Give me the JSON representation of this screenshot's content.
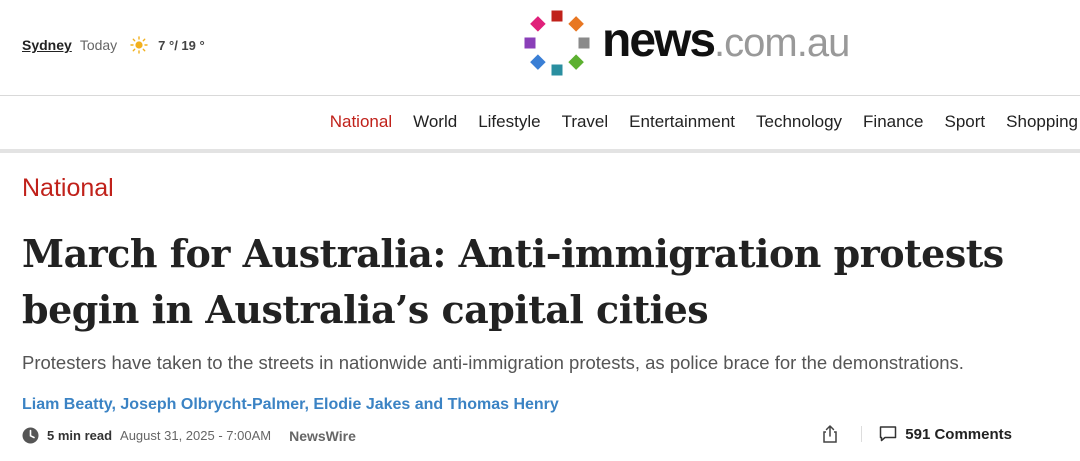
{
  "weather": {
    "city": "Sydney",
    "day": "Today",
    "icon": "sun-icon",
    "temperature": "7 °/ 19 °"
  },
  "logo": {
    "name": "news",
    "domain": ".com.au",
    "colors": [
      "#e0207a",
      "#c0211a",
      "#e87722",
      "#8a8a8a",
      "#5cb030",
      "#2a8fa0",
      "#3a7fd5",
      "#8a3fb8"
    ]
  },
  "nav": {
    "items": [
      "National",
      "World",
      "Lifestyle",
      "Travel",
      "Entertainment",
      "Technology",
      "Finance",
      "Sport",
      "Shopping"
    ],
    "active": "National"
  },
  "article": {
    "section": "National",
    "headline": "March for Australia: Anti-immigration protests begin in Australia’s capital cities",
    "standfirst": "Protesters have taken to the streets in nationwide anti-immigration protests, as police brace for the demonstrations.",
    "authors": [
      "Liam Beatty",
      "Joseph Olbrycht-Palmer",
      "Elodie Jakes",
      "Thomas Henry"
    ],
    "author_sep": ", ",
    "author_last_sep": " and ",
    "read_time": "5 min read",
    "date": "August 31, 2025 - 7:00AM",
    "source": "NewsWire",
    "comments": "591 Comments"
  },
  "colors": {
    "accent": "#c0211a",
    "author_link": "#3b83c4"
  }
}
